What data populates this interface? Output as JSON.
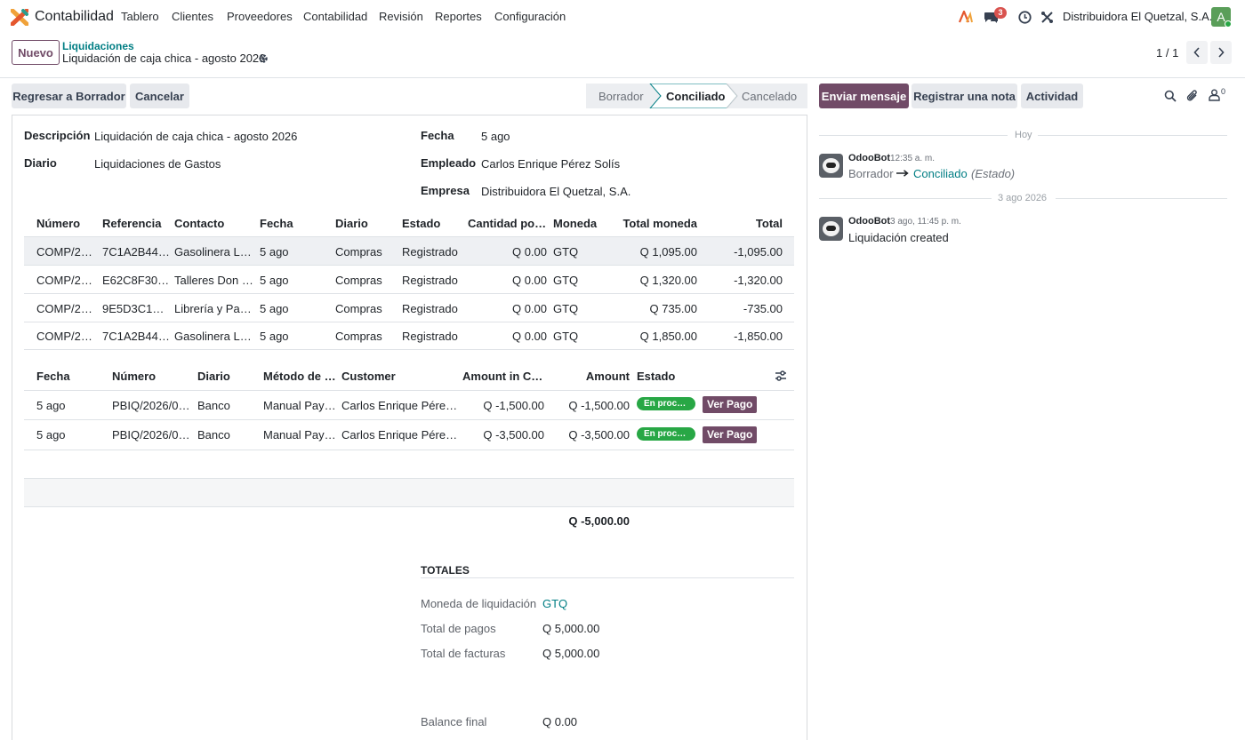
{
  "navbar": {
    "app_name": "Contabilidad",
    "menu": [
      "Tablero",
      "Clientes",
      "Proveedores",
      "Contabilidad",
      "Revisión",
      "Reportes",
      "Configuración"
    ],
    "chat_count": "3",
    "company": "Distribuidora El Quetzal, S.A.",
    "avatar_letter": "A"
  },
  "control_panel": {
    "new_button": "Nuevo",
    "breadcrumb_parent": "Liquidaciones",
    "record_title": "Liquidación de caja chica - agosto 2026",
    "pager": "1 / 1"
  },
  "statusbar": {
    "buttons": [
      "Regresar a Borrador",
      "Cancelar"
    ],
    "stages": [
      "Borrador",
      "Conciliado",
      "Cancelado"
    ],
    "active_stage": "Conciliado"
  },
  "form": {
    "descripcion_label": "Descripción",
    "descripcion_value": "Liquidación de caja chica - agosto 2026",
    "diario_label": "Diario",
    "diario_value": "Liquidaciones de Gastos",
    "fecha_label": "Fecha",
    "fecha_value": "5 ago",
    "empleado_label": "Empleado",
    "empleado_value": "Carlos Enrique Pérez Solís",
    "empresa_label": "Empresa",
    "empresa_value": "Distribuidora El Quetzal, S.A."
  },
  "invoices": {
    "headers": [
      "Número",
      "Referencia",
      "Contacto",
      "Fecha",
      "Diario",
      "Estado",
      "Cantidad por …",
      "Moneda",
      "Total moneda",
      "Total"
    ],
    "rows": [
      [
        "COMP/20…",
        "7C1A2B44…",
        "Gasolinera La …",
        "5 ago",
        "Compras",
        "Registrado",
        "Q 0.00",
        "GTQ",
        "Q 1,095.00",
        "-1,095.00"
      ],
      [
        "COMP/20…",
        "E62C8F30-…",
        "Talleres Don B…",
        "5 ago",
        "Compras",
        "Registrado",
        "Q 0.00",
        "GTQ",
        "Q 1,320.00",
        "-1,320.00"
      ],
      [
        "COMP/20…",
        "9E5D3C10…",
        "Librería y Pap…",
        "5 ago",
        "Compras",
        "Registrado",
        "Q 0.00",
        "GTQ",
        "Q 735.00",
        "-735.00"
      ],
      [
        "COMP/20…",
        "7C1A2B44…",
        "Gasolinera La …",
        "5 ago",
        "Compras",
        "Registrado",
        "Q 0.00",
        "GTQ",
        "Q 1,850.00",
        "-1,850.00"
      ]
    ]
  },
  "payments": {
    "headers": [
      "Fecha",
      "Número",
      "Diario",
      "Método de p…",
      "Customer",
      "Amount in Cu…",
      "Amount",
      "Estado"
    ],
    "rows": [
      [
        "5 ago",
        "PBIQ/2026/00…",
        "Banco",
        "Manual Pay…",
        "Carlos Enrique Pérez S…",
        "Q -1,500.00",
        "Q -1,500.00",
        "En proc…",
        "Ver Pago"
      ],
      [
        "5 ago",
        "PBIQ/2026/00…",
        "Banco",
        "Manual Pay…",
        "Carlos Enrique Pérez S…",
        "Q -3,500.00",
        "Q -3,500.00",
        "En proc…",
        "Ver Pago"
      ]
    ],
    "total": "Q -5,000.00"
  },
  "totals": {
    "section_title": "TOTALES",
    "moneda_label": "Moneda de liquidación",
    "moneda_value": "GTQ",
    "pagos_label": "Total de pagos",
    "pagos_value": "Q 5,000.00",
    "facturas_label": "Total de facturas",
    "facturas_value": "Q 5,000.00",
    "balance_label": "Balance final",
    "balance_value": "Q 0.00"
  },
  "chatter": {
    "send_message": "Enviar mensaje",
    "log_note": "Registrar una nota",
    "activity": "Actividad",
    "follower_count": "0",
    "separator_today": "Hoy",
    "separator_date": "3 ago 2026",
    "messages": [
      {
        "author": "OdooBot",
        "time": "12:35 a. m.",
        "from": "Borrador",
        "to": "Conciliado",
        "field": "(Estado)"
      },
      {
        "author": "OdooBot",
        "time": "3 ago, 11:45 p. m.",
        "body": "Liquidación created"
      }
    ]
  },
  "colors": {
    "brand": "#714b67",
    "link": "#017e84",
    "success": "#28a745"
  }
}
